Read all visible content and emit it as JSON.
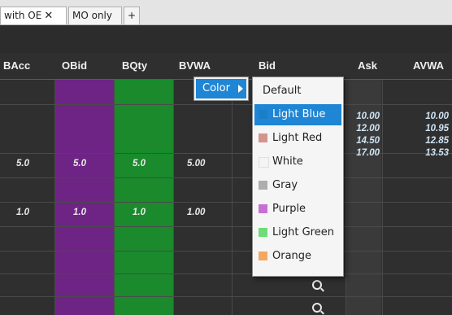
{
  "tabs": [
    {
      "label": "with OE",
      "close": "✕",
      "active": true
    },
    {
      "label": "MO only",
      "active": false
    }
  ],
  "add_tab": "+",
  "columns": {
    "bacc": "BAcc",
    "obid": "OBid",
    "bqty": "BQty",
    "bvwa": "BVWA",
    "bid": "Bid",
    "ask": "Ask",
    "avwa": "AVWA"
  },
  "rows": {
    "r1": {
      "bacc": "5.0",
      "obid": "5.0",
      "bqty": "5.0",
      "bvwa": "5.00"
    },
    "r2": {
      "bacc": "1.0",
      "obid": "1.0",
      "bqty": "1.0",
      "bvwa": "1.00"
    }
  },
  "ask_values": [
    "10.00",
    "12.00",
    "14.50",
    "17.00"
  ],
  "avwa_values": [
    "10.00",
    "10.95",
    "12.85",
    "13.53"
  ],
  "context_menu": {
    "color_label": "Color"
  },
  "color_options": [
    {
      "label": "Default",
      "color": ""
    },
    {
      "label": "Light Blue",
      "color": "#1b7fc7"
    },
    {
      "label": "Light Red",
      "color": "#d4938e"
    },
    {
      "label": "White",
      "color": "#f4f4f4"
    },
    {
      "label": "Gray",
      "color": "#adadad"
    },
    {
      "label": "Purple",
      "color": "#c76fd3"
    },
    {
      "label": "Light Green",
      "color": "#6fdc78"
    },
    {
      "label": "Orange",
      "color": "#f5a760"
    }
  ],
  "colors": {
    "obid_column": "#6e2485",
    "bqty_column": "#1a8a2c",
    "selected_item": "#1e86d4",
    "grid_background": "#2f2f2f"
  }
}
